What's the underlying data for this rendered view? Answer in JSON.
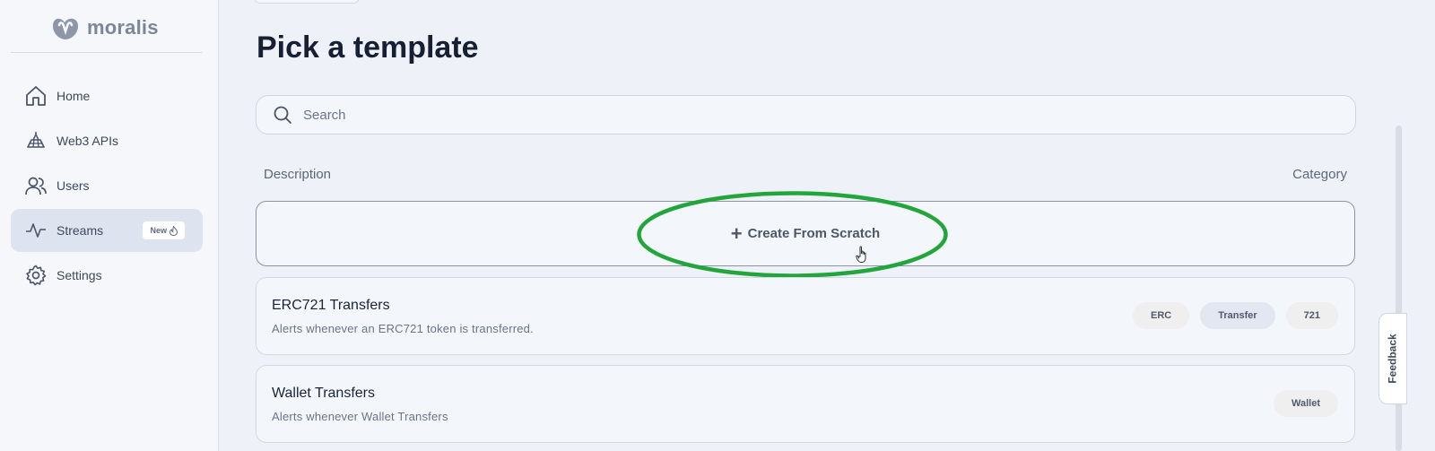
{
  "sidebar": {
    "logo_text": "moralis",
    "items": [
      {
        "label": "Home",
        "icon": "home-icon"
      },
      {
        "label": "Web3 APIs",
        "icon": "web3-apis-icon"
      },
      {
        "label": "Users",
        "icon": "users-icon"
      },
      {
        "label": "Streams",
        "icon": "activity-pulse-icon",
        "badge": "New",
        "active": true
      },
      {
        "label": "Settings",
        "icon": "gear-icon"
      }
    ]
  },
  "main": {
    "title": "Pick a template",
    "search": {
      "placeholder": "Search",
      "value": ""
    },
    "columns": {
      "description": "Description",
      "category": "Category"
    },
    "create_from_scratch": "Create From Scratch",
    "templates": [
      {
        "name": "ERC721 Transfers",
        "description": "Alerts whenever an ERC721 token is transferred.",
        "tags": [
          "ERC",
          "Transfer",
          "721"
        ]
      },
      {
        "name": "Wallet Transfers",
        "description": "Alerts whenever Wallet Transfers",
        "tags": [
          "Wallet"
        ]
      }
    ]
  },
  "feedback_label": "Feedback",
  "colors": {
    "highlight_ring": "#22a63c",
    "active_nav": "#dde4f0",
    "tag_blue": "#e2e7f2"
  }
}
